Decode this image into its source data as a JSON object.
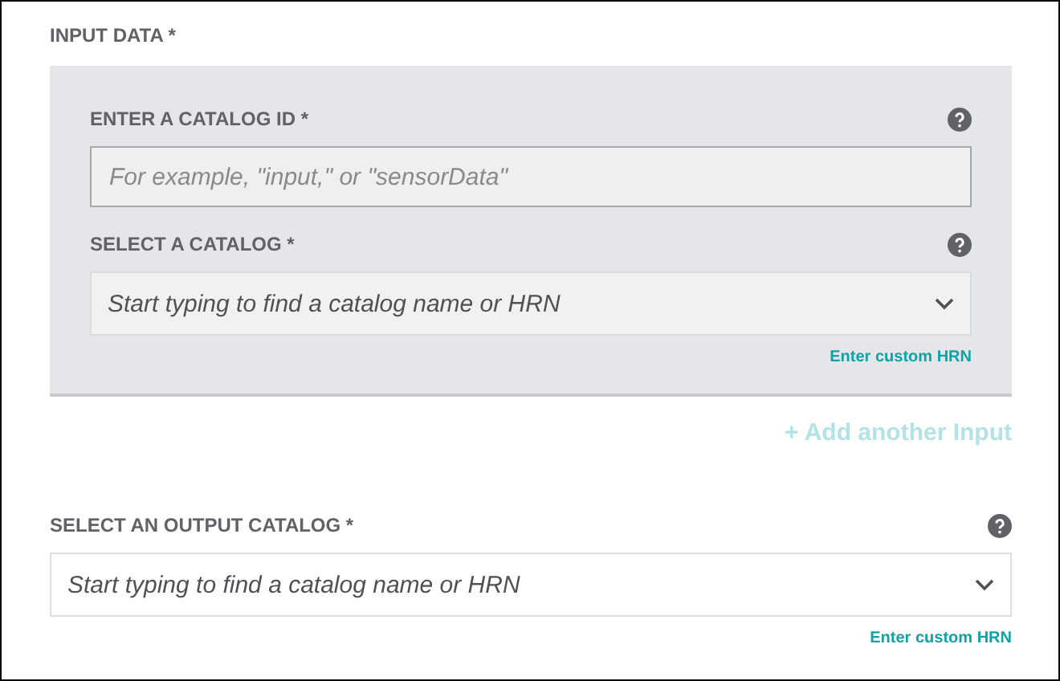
{
  "input_section": {
    "title": "INPUT DATA *",
    "inputs": [
      {
        "kind": "text",
        "label": "ENTER A CATALOG ID *",
        "placeholder": "For example, \"input,\" or \"sensorData\""
      },
      {
        "kind": "select",
        "label": "SELECT A CATALOG *",
        "placeholder": "Start typing to find a catalog name or HRN",
        "link": "Enter custom HRN"
      }
    ],
    "add_button": {
      "label": "+ Add another Input",
      "disabled": true
    }
  },
  "output_section": {
    "label": "SELECT AN OUTPUT CATALOG *",
    "placeholder": "Start typing to find a catalog name or HRN",
    "link": "Enter custom HRN"
  }
}
